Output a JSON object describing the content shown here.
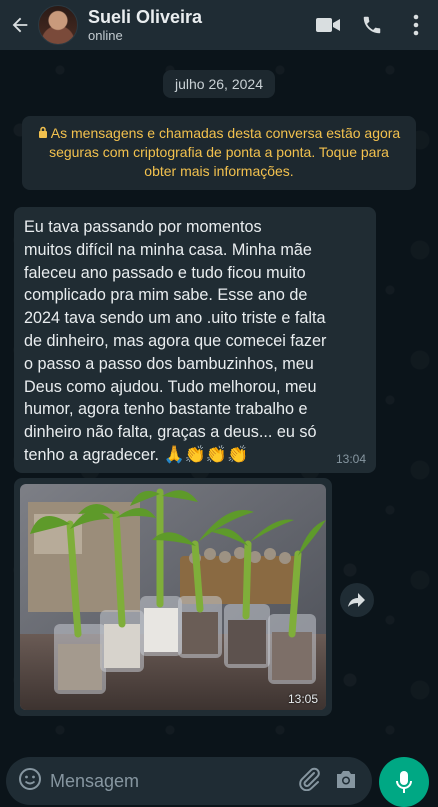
{
  "header": {
    "contact_name": "Sueli Oliveira",
    "status": "online",
    "icons": [
      "back-arrow-icon",
      "video-call-icon",
      "phone-icon",
      "more-vert-icon"
    ]
  },
  "chat": {
    "date_label": "julho 26, 2024",
    "encryption_notice": "As mensagens e chamadas desta conversa estão agora seguras com criptografia de ponta a ponta. Toque para obter mais informações.",
    "messages": [
      {
        "text": "Eu tava passando por momentos\nmuitos difícil na minha casa. Minha mãe\nfaleceu ano passado e tudo ficou muito\ncomplicado pra mim sabe. Esse ano de\n2024 tava sendo um ano .uito triste e falta\nde dinheiro, mas agora que comecei fazer\no passo a passo dos bambuzinhos, meu\nDeus como ajudou. Tudo melhorou, meu\nhumor, agora tenho bastante trabalho e\ndinheiro não falta, graças a deus... eu só\ntenho a agradecer.",
        "emojis": "🙏👏👏👏",
        "time": "13:04"
      },
      {
        "type": "image",
        "time": "13:05"
      }
    ]
  },
  "composer": {
    "placeholder": "Mensagem"
  },
  "colors": {
    "header_bg": "#1f2c34",
    "chat_bg": "#0b141a",
    "bubble_bg": "#202c33",
    "accent": "#00a884",
    "notice_text": "#f2c14e"
  }
}
